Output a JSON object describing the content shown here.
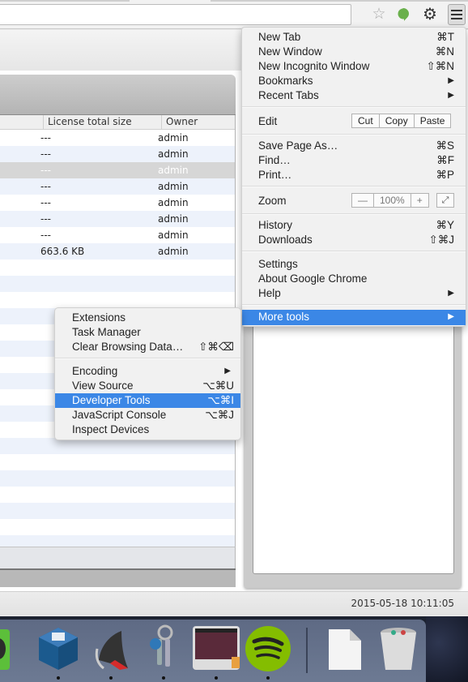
{
  "toolbar": {
    "icons": [
      "bookmark-star-icon",
      "extension-green-icon",
      "extension-gear-icon",
      "chrome-menu-icon"
    ]
  },
  "table": {
    "columns": [
      "License total size",
      "Owner"
    ],
    "rows": [
      {
        "size": "---",
        "owner": "admin"
      },
      {
        "size": "---",
        "owner": "admin"
      },
      {
        "size": "---",
        "owner": "admin",
        "selected": true
      },
      {
        "size": "---",
        "owner": "admin"
      },
      {
        "size": "---",
        "owner": "admin"
      },
      {
        "size": "---",
        "owner": "admin"
      },
      {
        "size": "---",
        "owner": "admin"
      },
      {
        "size": "663.6 KB",
        "owner": "admin"
      }
    ]
  },
  "status": {
    "timestamp": "2015-05-18 10:11:05"
  },
  "chrome_menu": {
    "items": [
      {
        "label": "New Tab",
        "shortcut": "⌘T"
      },
      {
        "label": "New Window",
        "shortcut": "⌘N"
      },
      {
        "label": "New Incognito Window",
        "shortcut": "⇧⌘N"
      },
      {
        "label": "Bookmarks",
        "arrow": "▶"
      },
      {
        "label": "Recent Tabs",
        "arrow": "▶"
      }
    ],
    "edit": {
      "label": "Edit",
      "cut": "Cut",
      "copy": "Copy",
      "paste": "Paste"
    },
    "file_items": [
      {
        "label": "Save Page As…",
        "shortcut": "⌘S"
      },
      {
        "label": "Find…",
        "shortcut": "⌘F"
      },
      {
        "label": "Print…",
        "shortcut": "⌘P"
      }
    ],
    "zoom": {
      "label": "Zoom",
      "minus": "—",
      "value": "100%",
      "plus": "+",
      "fullscreen": "⤢"
    },
    "history_items": [
      {
        "label": "History",
        "shortcut": "⌘Y"
      },
      {
        "label": "Downloads",
        "shortcut": "⇧⌘J"
      }
    ],
    "settings_items": [
      {
        "label": "Settings"
      },
      {
        "label": "About Google Chrome"
      },
      {
        "label": "Help",
        "arrow": "▶"
      }
    ],
    "more_tools": {
      "label": "More tools",
      "arrow": "▶",
      "highlighted": true
    }
  },
  "more_tools_menu": {
    "items": [
      {
        "label": "Extensions"
      },
      {
        "label": "Task Manager"
      },
      {
        "label": "Clear Browsing Data…",
        "shortcut": "⇧⌘⌫"
      },
      {
        "label": "Encoding",
        "arrow": "▶"
      },
      {
        "label": "View Source",
        "shortcut": "⌥⌘U"
      },
      {
        "label": "Developer Tools",
        "shortcut": "⌥⌘I",
        "highlighted": true
      },
      {
        "label": "JavaScript Console",
        "shortcut": "⌥⌘J"
      },
      {
        "label": "Inspect Devices"
      }
    ]
  },
  "dock": {
    "items": [
      "evernote",
      "virtualbox",
      "crossover",
      "keychain-access",
      "vm-screen",
      "spotify",
      "documents",
      "trash"
    ]
  },
  "colors": {
    "highlight": "#3b87e6",
    "row_alt": "#edf2fb",
    "selected_row": "#d6d6d6"
  }
}
